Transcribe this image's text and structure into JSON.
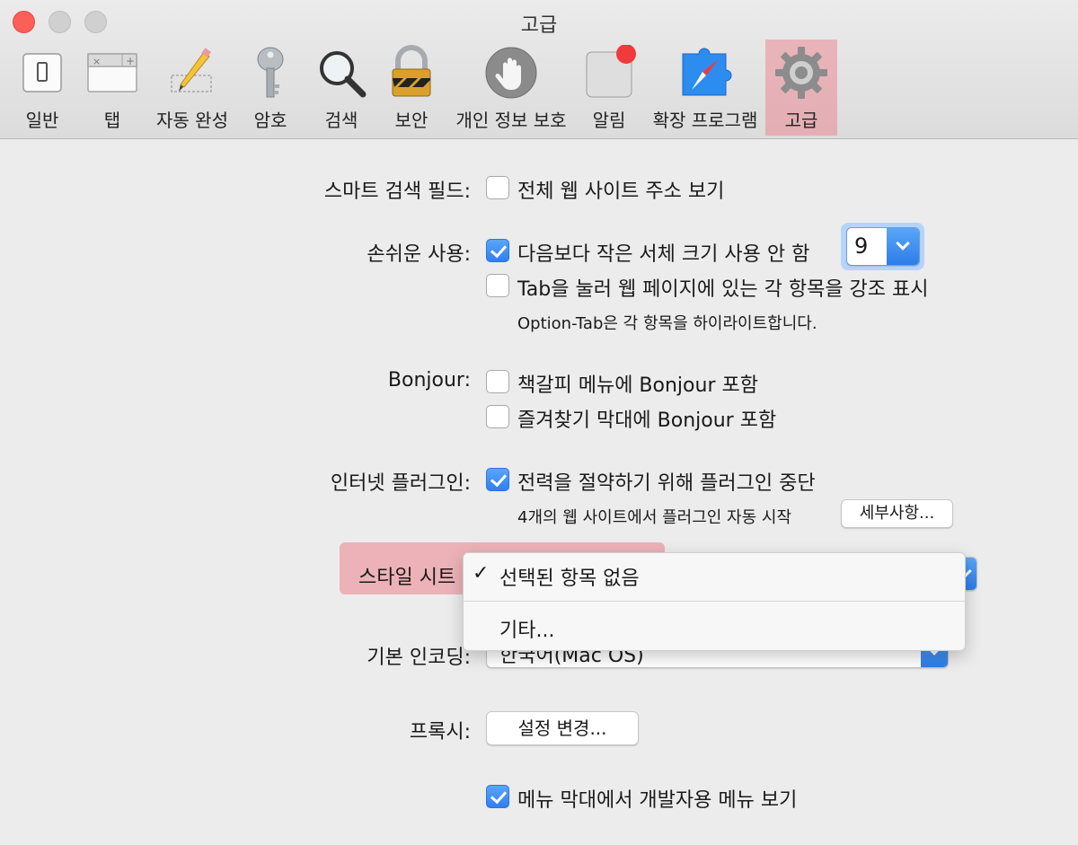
{
  "window": {
    "title": "고급"
  },
  "toolbar": {
    "items": [
      {
        "label": "일반",
        "icon": "general-switch-icon"
      },
      {
        "label": "탭",
        "icon": "tabs-icon"
      },
      {
        "label": "자동 완성",
        "icon": "pencil-icon"
      },
      {
        "label": "암호",
        "icon": "key-icon"
      },
      {
        "label": "검색",
        "icon": "magnifier-icon"
      },
      {
        "label": "보안",
        "icon": "lock-icon"
      },
      {
        "label": "개인 정보 보호",
        "icon": "hand-icon"
      },
      {
        "label": "알림",
        "icon": "notification-icon"
      },
      {
        "label": "확장 프로그램",
        "icon": "compass-puzzle-icon"
      },
      {
        "label": "고급",
        "icon": "gear-icon",
        "selected": true
      }
    ]
  },
  "settings": {
    "smart_search": {
      "label": "스마트 검색 필드:",
      "option": "전체 웹 사이트 주소 보기",
      "checked": false
    },
    "accessibility": {
      "label": "손쉬운 사용:",
      "min_font": {
        "text": "다음보다 작은 서체 크기 사용 안 함",
        "checked": true,
        "value": "9"
      },
      "tab_highlight": {
        "text": "Tab을 눌러 웹 페이지에 있는 각 항목을 강조 표시",
        "checked": false
      },
      "hint": "Option-Tab은 각 항목을 하이라이트합니다."
    },
    "bonjour": {
      "label": "Bonjour:",
      "bookmarks": {
        "text": "책갈피 메뉴에 Bonjour 포함",
        "checked": false
      },
      "favorites": {
        "text": "즐겨찾기 막대에 Bonjour 포함",
        "checked": false
      }
    },
    "plugins": {
      "label": "인터넷 플러그인:",
      "save_power": {
        "text": "전력을 절약하기 위해 플러그인 중단",
        "checked": true
      },
      "auto_start": "4개의 웹 사이트에서 플러그인 자동 시작",
      "details_button": "세부사항..."
    },
    "style_sheet": {
      "label": "스타일 시트",
      "menu": {
        "selected": "선택된 항목 없음",
        "check": "✓",
        "other": "기타..."
      }
    },
    "encoding": {
      "label": "기본 인코딩:",
      "value": "한국어(Mac OS)"
    },
    "proxy": {
      "label": "프록시:",
      "button": "설정 변경..."
    },
    "develop_menu": {
      "text": "메뉴 막대에서 개발자용 메뉴 보기",
      "checked": true
    }
  },
  "colors": {
    "accent": "#2f7ff0",
    "highlight": "#ec7882",
    "close": "#fc5f57"
  }
}
